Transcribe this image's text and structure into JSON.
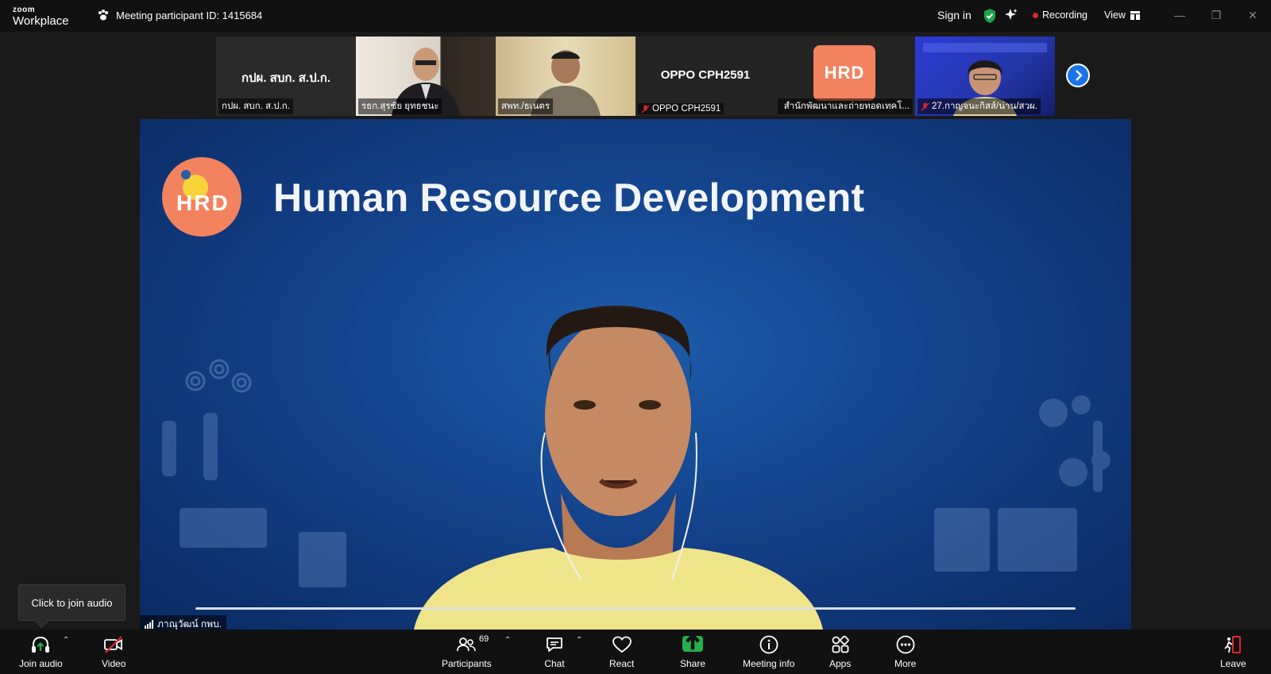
{
  "app": {
    "brand_small": "zoom",
    "brand_large": "Workplace"
  },
  "header": {
    "meeting_label": "Meeting participant ID: 1415684",
    "sign_in": "Sign in",
    "recording": "Recording",
    "view": "View"
  },
  "strip": {
    "tiles": [
      {
        "center": "กปผ. สบก. ส.ป.ก.",
        "label": "กปผ. สบก. ส.ป.ก.",
        "muted": false
      },
      {
        "center": "",
        "label": "รธก.สุรชัย ยุทธชนะ",
        "muted": false
      },
      {
        "center": "",
        "label": "สพท./ธเนตร",
        "muted": false
      },
      {
        "center": "OPPO CPH2591",
        "label": "OPPO CPH2591",
        "muted": true
      },
      {
        "center": "",
        "label": "สำนักพัฒนาและถ่ายทอดเทคโ...",
        "muted": true
      },
      {
        "center": "",
        "label": "27.กาญจนะกิสส์/น่าน/สวผ.",
        "muted": true
      }
    ]
  },
  "stage": {
    "slide_title": "Human Resource Development",
    "logo_text": "HRD",
    "speaker_name": "ภาณุวัฒน์ กพบ."
  },
  "tooltip": {
    "text": "Click to join audio"
  },
  "toolbar": {
    "join_audio": "Join audio",
    "video": "Video",
    "participants": "Participants",
    "participants_count": "69",
    "chat": "Chat",
    "react": "React",
    "share": "Share",
    "meeting_info": "Meeting info",
    "apps": "Apps",
    "more": "More",
    "leave": "Leave"
  },
  "colors": {
    "share_green": "#22b14c",
    "leave_red": "#e0262e",
    "stage_blue": "#1c5cab",
    "logo_orange": "#f3835f"
  }
}
